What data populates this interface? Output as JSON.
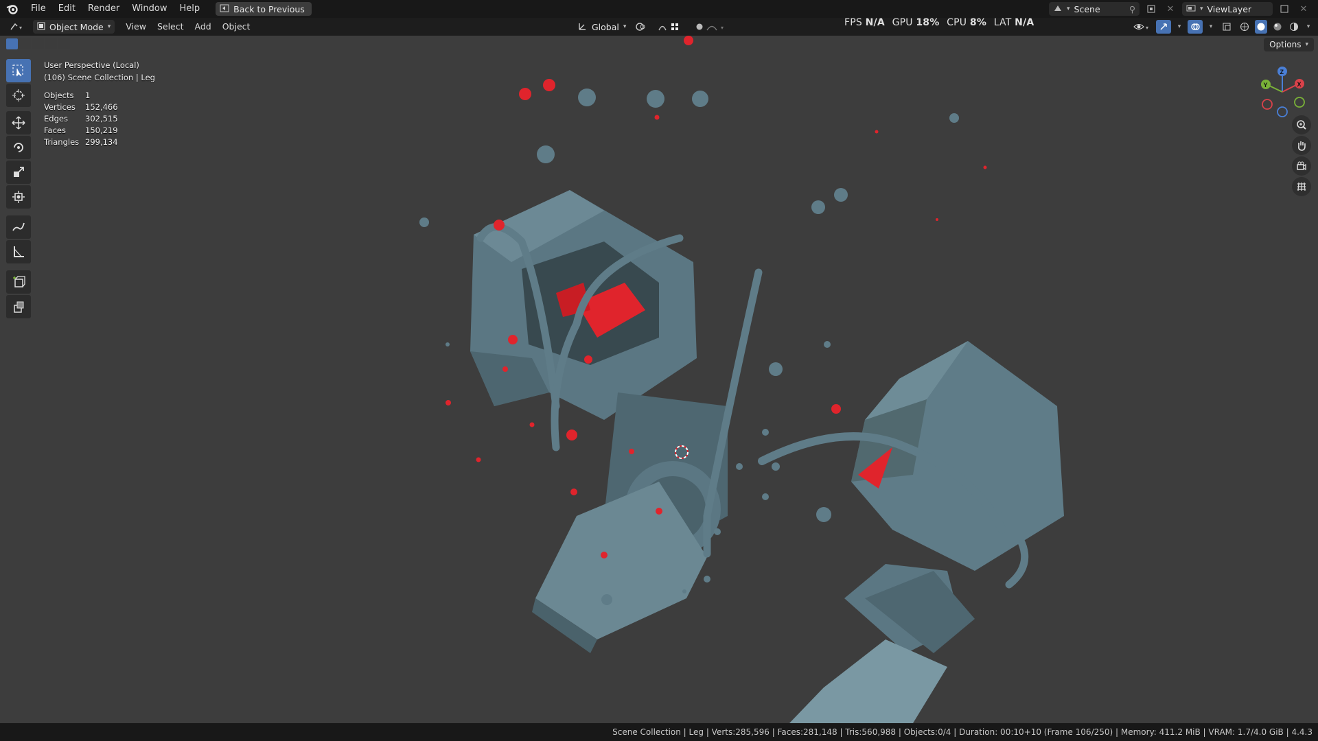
{
  "menu": {
    "items": [
      "File",
      "Edit",
      "Render",
      "Window",
      "Help"
    ],
    "back_button": "Back to Previous"
  },
  "top_right": {
    "scene_name": "Scene",
    "view_layer": "ViewLayer"
  },
  "header": {
    "mode": "Object Mode",
    "menus": [
      "View",
      "Select",
      "Add",
      "Object"
    ],
    "orientation": "Global"
  },
  "perf": {
    "fps_label": "FPS",
    "fps_value": "N/A",
    "gpu_label": "GPU",
    "gpu_value": "18%",
    "cpu_label": "CPU",
    "cpu_value": "8%",
    "lat_label": "LAT",
    "lat_value": "N/A"
  },
  "viewport": {
    "view_name": "User Perspective (Local)",
    "collection_line": "(106) Scene Collection | Leg",
    "stats": [
      {
        "label": "Objects",
        "value": "1"
      },
      {
        "label": "Vertices",
        "value": "152,466"
      },
      {
        "label": "Edges",
        "value": "302,515"
      },
      {
        "label": "Faces",
        "value": "150,219"
      },
      {
        "label": "Triangles",
        "value": "299,134"
      }
    ],
    "options_label": "Options",
    "gizmo": {
      "x": "X",
      "y": "Y",
      "z": "Z"
    }
  },
  "statusbar": {
    "text": "Scene Collection | Leg | Verts:285,596 | Faces:281,148 | Tris:560,988 | Objects:0/4 | Duration: 00:10+10 (Frame 106/250) | Memory: 411.2 MiB | VRAM: 1.7/4.0 GiB | 4.4.3"
  },
  "colors": {
    "accent": "#4772b3",
    "viewport_bg": "#3d3d3d",
    "model_body": "#5f7c88",
    "model_dark": "#3f545c",
    "highlight_red": "#e0242c"
  },
  "icons": [
    "blender-logo-icon",
    "back-icon",
    "scene-icon",
    "pin-icon",
    "new-scene-icon",
    "close-icon",
    "view-layer-icon",
    "editor-type-icon",
    "object-mode-icon",
    "orientation-icon",
    "pivot-icon",
    "snap-icon",
    "proportional-icon",
    "select-box-icon",
    "cursor-icon",
    "move-icon",
    "rotate-icon",
    "scale-icon",
    "transform-icon",
    "annotate-icon",
    "measure-icon",
    "add-cube-icon",
    "extrude-icon",
    "zoom-icon",
    "hand-icon",
    "camera-icon",
    "grid-icon",
    "visibility-icon",
    "gizmo-icon",
    "overlay-icon",
    "xray-icon",
    "wireframe-shading-icon",
    "solid-shading-icon",
    "material-shading-icon",
    "rendered-shading-icon"
  ]
}
